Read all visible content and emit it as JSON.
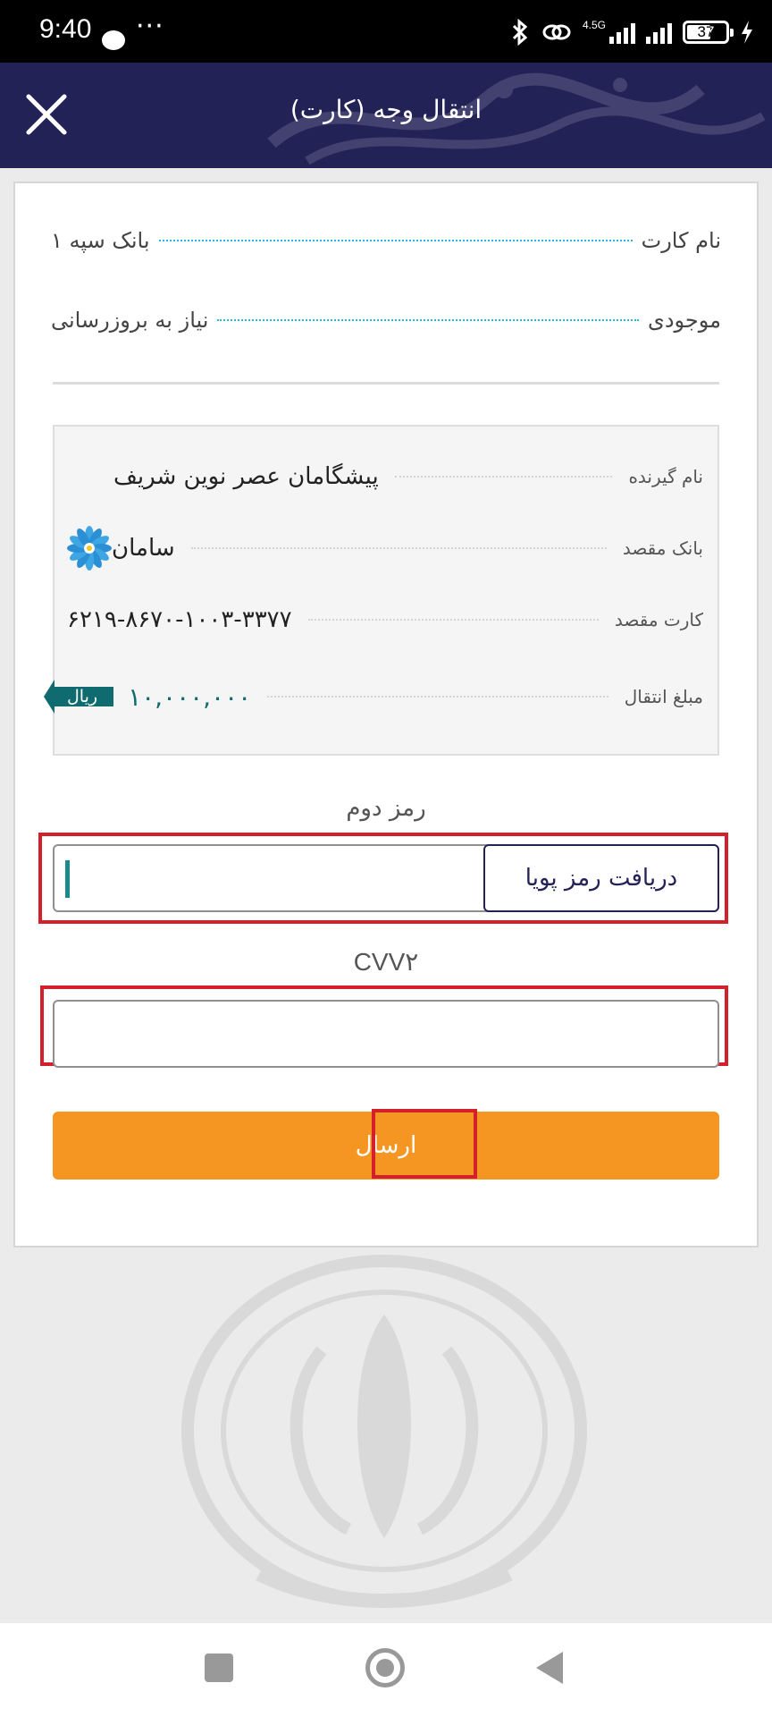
{
  "status_bar": {
    "time": "9:40",
    "dots": "···",
    "network": "4.5G",
    "battery": "37"
  },
  "header": {
    "title": "انتقال وجه (کارت)",
    "close_icon": "close-icon"
  },
  "card_info": {
    "card_name_label": "نام کارت",
    "card_name_value": "بانک سپه ۱",
    "balance_label": "موجودی",
    "balance_value": "نیاز به بروزرسانی"
  },
  "receipt": {
    "recipient_label": "نام گیرنده",
    "recipient_value": "پیشگامان عصر نوین شریف",
    "dest_bank_label": "بانک مقصد",
    "dest_bank_value": "سامان",
    "dest_card_label": "کارت مقصد",
    "dest_card_value": "۶۲۱۹-۸۶۷۰-۱۰۰۳-۳۳۷۷",
    "amount_label": "مبلغ انتقال",
    "amount_value": "۱۰,۰۰۰,۰۰۰",
    "currency": "ریال"
  },
  "form": {
    "second_password_label": "رمز دوم",
    "second_password_value": "",
    "dynamic_password_button": "دریافت رمز پویا",
    "cvv2_label": "CVV۲",
    "cvv2_value": "",
    "submit_button": "ارسال"
  },
  "colors": {
    "header": "#232257",
    "accent": "#f59622",
    "teal": "#0f6b70",
    "highlight": "#d4202a"
  }
}
